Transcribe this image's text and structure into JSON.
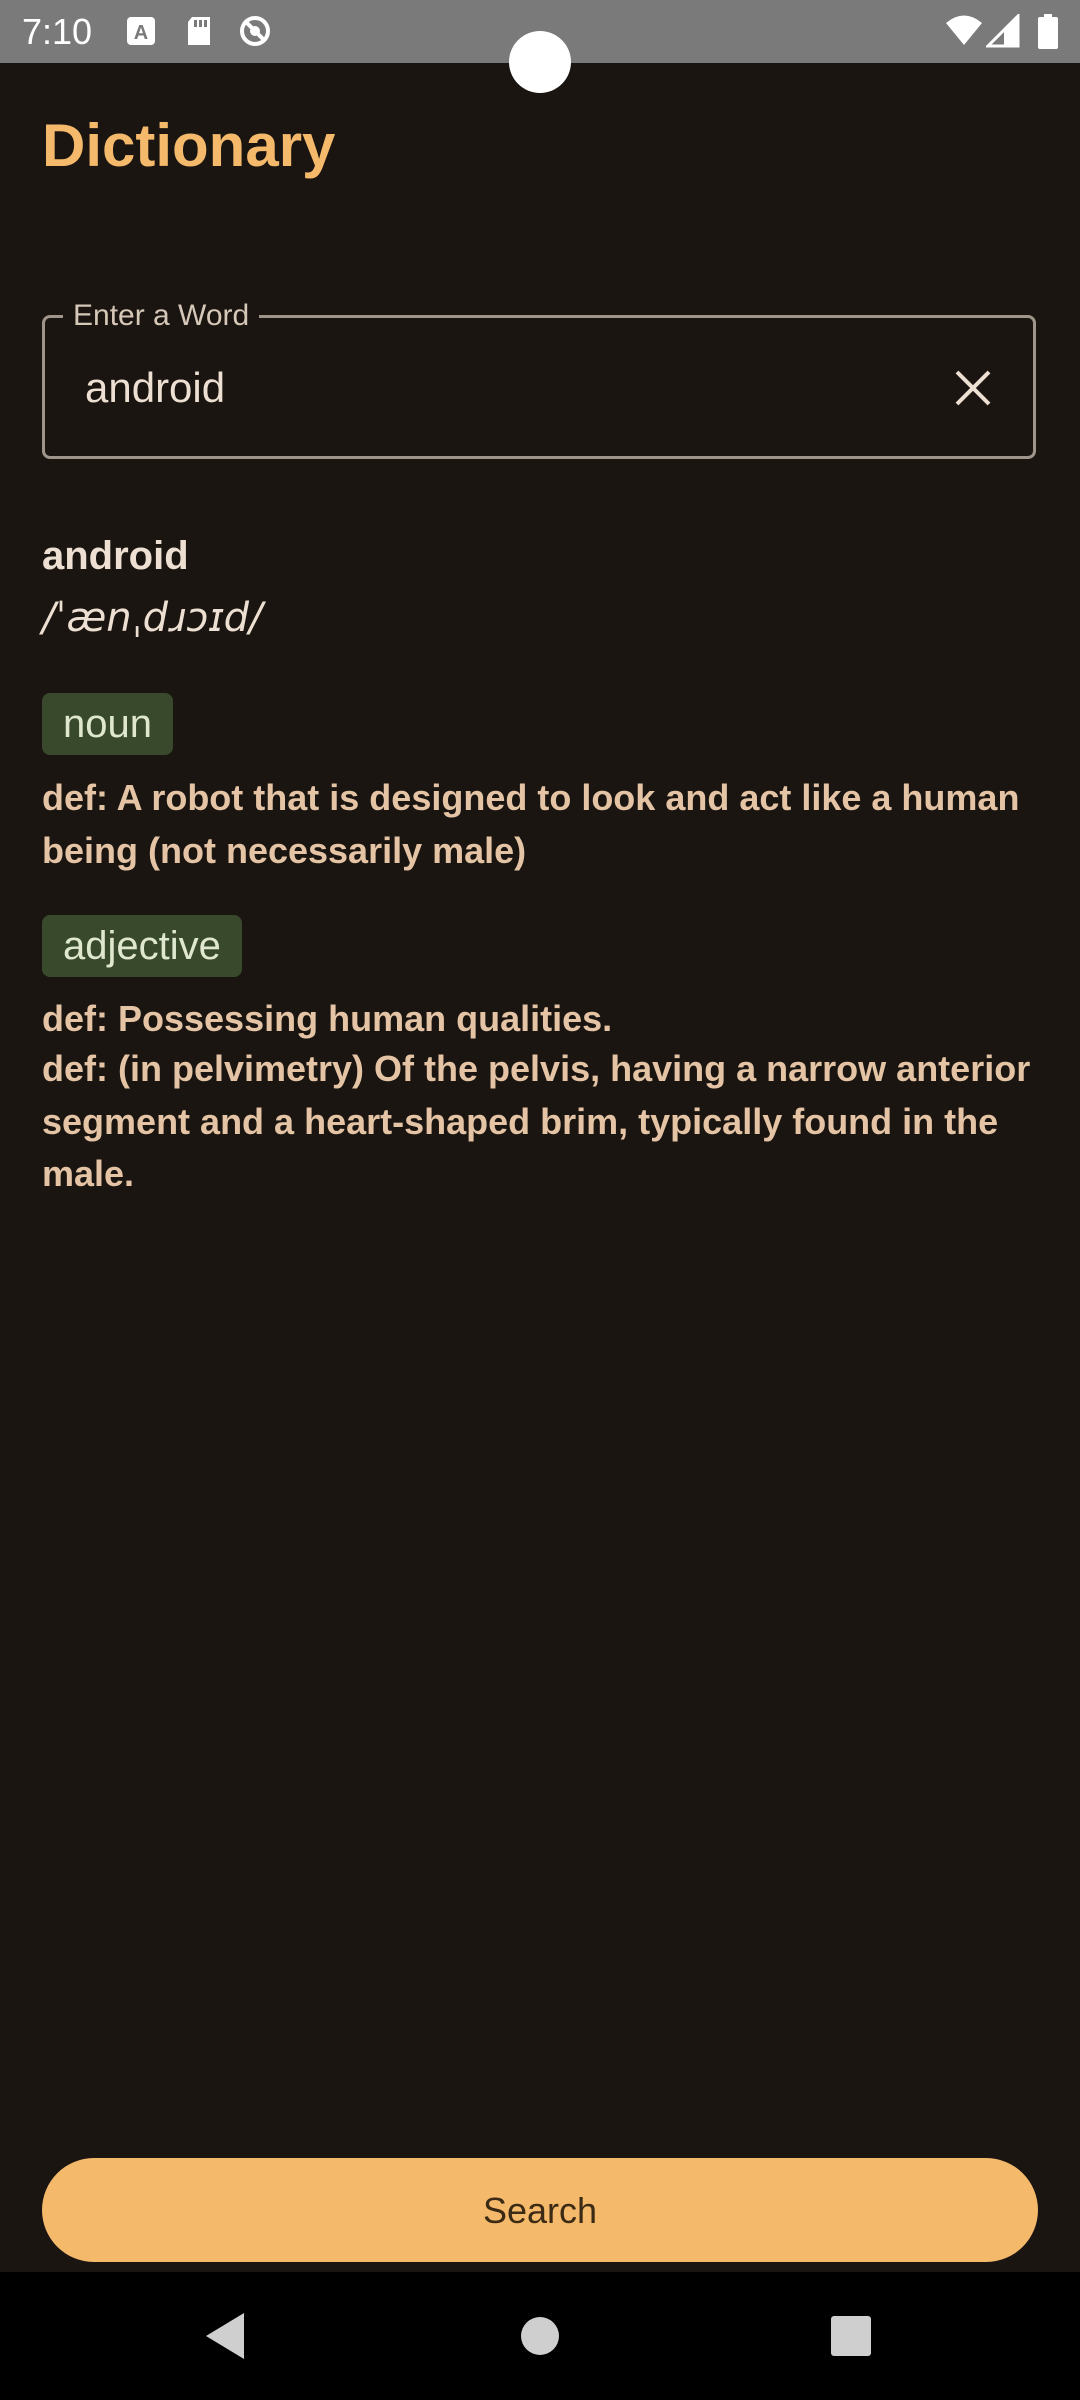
{
  "status_bar": {
    "time": "7:10",
    "icons_left": [
      "a-box-icon",
      "sd-card-icon",
      "no-sync-icon"
    ],
    "icons_right": [
      "wifi-icon",
      "cell-signal-icon",
      "battery-icon"
    ]
  },
  "app": {
    "title": "Dictionary"
  },
  "search": {
    "label": "Enter a Word",
    "value": "android",
    "clear_icon": "close-icon"
  },
  "result": {
    "word": "android",
    "phonetic": "/ˈænˌdɹɔɪd/",
    "meanings": [
      {
        "part_of_speech": "noun",
        "definitions": [
          "def: A robot that is designed to look and act like a human being (not necessarily male)"
        ]
      },
      {
        "part_of_speech": "adjective",
        "definitions": [
          "def: Possessing human qualities.",
          "def: (in pelvimetry) Of the pelvis, having a narrow anterior segment and a heart-shaped brim, typically found in the male."
        ]
      }
    ]
  },
  "actions": {
    "search_label": "Search"
  },
  "nav": {
    "back_icon": "back-triangle-icon",
    "home_icon": "home-circle-icon",
    "recents_icon": "recents-square-icon"
  },
  "colors": {
    "background": "#1a1511",
    "accent": "#f5b96b",
    "badge": "#394a2c",
    "definition_text": "#e4c4a4"
  }
}
